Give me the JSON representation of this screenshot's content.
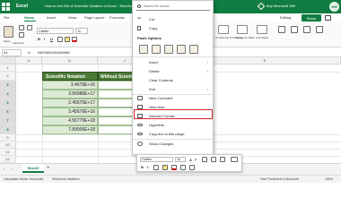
{
  "titlebar": {
    "app_name": "Excel",
    "doc_title": "How to Get Rid of Scientific Notation in Excel - Sheetnaks - Saved",
    "buy_link": "Buy Microsoft 365",
    "avatar_initials": "KM",
    "accent": "#107c41"
  },
  "ribbon_tabs": [
    {
      "label": "File"
    },
    {
      "label": "Home"
    },
    {
      "label": "Insert"
    },
    {
      "label": "Draw"
    },
    {
      "label": "Page Layout"
    },
    {
      "label": "Formulas"
    },
    {
      "label": "Data"
    },
    {
      "label": "Editing"
    }
  ],
  "share_label": "Share",
  "ribbon": {
    "paste_label": "Paste",
    "clipboard_label": "Clipboard",
    "font_name": "Calibri",
    "font_size": "11",
    "bold": "B",
    "italic": "I",
    "underline": "U",
    "right_group_labels": [
      "Conditional Formatting",
      "Format As Table",
      "Cell Styles"
    ]
  },
  "formula_bar": {
    "name_box": "A1",
    "fx": "fx",
    "content": "0467895431569468"
  },
  "grid": {
    "columns": [
      "A",
      "B",
      "C",
      "D",
      "E"
    ],
    "rows": [
      "1",
      "2",
      "3",
      "4",
      "5",
      "6",
      "7",
      "8",
      "9",
      "10",
      "11",
      "12"
    ],
    "table_headers": [
      "Scientific Notation",
      "Without Scientific"
    ],
    "values": [
      "3.4679E+16",
      "3.56986E+17",
      "2.45675E+17",
      "3.45676E+16",
      "4.56779E+18",
      "7.89006E+18"
    ]
  },
  "sheetbar": {
    "sheet_tab": "Sheet1",
    "add": "+"
  },
  "statusbar": {
    "left": "Calculation Mode: Automatic",
    "middle": "Workbook Statistics",
    "right": "Give Feedback to Microsoft",
    "zoom": "100%"
  },
  "context_menu": {
    "search_placeholder": "Search the menus",
    "items_top": [
      {
        "label": "Cut",
        "icon": "scissors-icon"
      },
      {
        "label": "Copy",
        "icon": "copy-icon"
      }
    ],
    "paste_options_label": "Paste Options",
    "items_mid": [
      {
        "label": "Insert",
        "has_arrow": true
      },
      {
        "label": "Delete",
        "has_arrow": true
      },
      {
        "label": "Clear Contents"
      },
      {
        "label": "Sort",
        "has_arrow": true
      }
    ],
    "items_bottom": [
      {
        "label": "New Comment",
        "icon": "new-comment-icon"
      },
      {
        "label": "New Note",
        "icon": "note-icon"
      },
      {
        "label": "Number Format...",
        "icon": "number-format-icon"
      },
      {
        "label": "Hyperlink...",
        "icon": "link-icon"
      },
      {
        "label": "Copy link to this range",
        "icon": "copy-link-icon"
      },
      {
        "label": "Show Changes",
        "icon": "show-changes-icon"
      }
    ],
    "highlight_color": "#d9272e"
  },
  "minibar": {
    "font_name": "Calibri",
    "font_size": "11",
    "bold": "B",
    "italic": "I",
    "underline": "U"
  }
}
